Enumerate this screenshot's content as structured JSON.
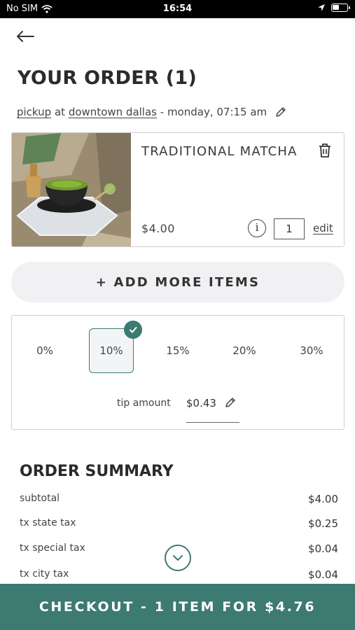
{
  "status_bar": {
    "carrier": "No SIM",
    "time": "16:54"
  },
  "header": {
    "title": "YOUR ORDER (1)",
    "order_type": "pickup",
    "at_word": "at",
    "location": "downtown dallas",
    "schedule": "- monday, 07:15 am"
  },
  "item": {
    "name": "TRADITIONAL MATCHA",
    "price": "$4.00",
    "info_label": "i",
    "quantity": "1",
    "edit_label": "edit"
  },
  "add_more_label": "+ ADD MORE ITEMS",
  "tip": {
    "options": [
      "0%",
      "10%",
      "15%",
      "20%",
      "30%"
    ],
    "selected_option": "10%",
    "amount_label": "tip amount",
    "amount_value": "$0.43"
  },
  "summary": {
    "title": "ORDER SUMMARY",
    "rows": [
      {
        "label": "subtotal",
        "amount": "$4.00"
      },
      {
        "label": "tx state tax",
        "amount": "$0.25"
      },
      {
        "label": "tx special tax",
        "amount": "$0.04"
      },
      {
        "label": "tx city tax",
        "amount": "$0.04"
      }
    ]
  },
  "checkout_label": "CHECKOUT - 1 ITEM FOR $4.76",
  "colors": {
    "accent": "#3c7a72",
    "text": "#2b2b2b",
    "border": "#cfcfcf",
    "pill_bg": "#f1f1f4"
  },
  "icons": {
    "back": "arrow-left-icon",
    "edit": "pencil-icon",
    "delete": "trash-icon",
    "info": "info-icon",
    "selected": "check-icon",
    "scroll": "chevron-down-icon"
  }
}
